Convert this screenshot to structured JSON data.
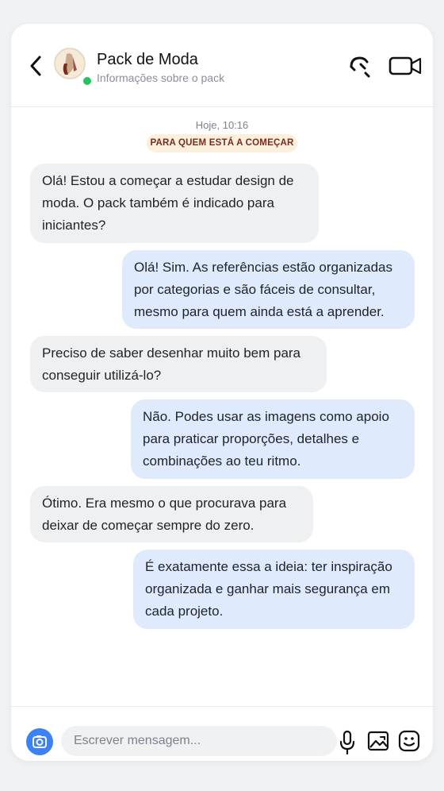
{
  "header": {
    "title": "Pack de Moda",
    "subtitle": "Informações sobre o pack",
    "back_icon": "chevron-left-icon",
    "call_icon": "phone-icon",
    "video_icon": "video-camera-icon",
    "status": "online",
    "status_color": "#22c55e"
  },
  "conversation": {
    "date_label": "Hoje, 10:16",
    "topic_badge": "PARA QUEM ESTÁ A COMEÇAR",
    "messages": [
      {
        "side": "incoming",
        "text": "Olá! Estou a começar a estudar design de\nmoda. O pack também é indicado para\niniciantes?"
      },
      {
        "side": "outgoing",
        "text": "Olá! Sim. As referências estão organizadas\npor categorias e são fáceis de consultar,\nmesmo para quem ainda está a aprender."
      },
      {
        "side": "incoming",
        "text": "Preciso de saber desenhar muito bem para\nconseguir utilizá-lo?"
      },
      {
        "side": "outgoing",
        "text": "Não. Podes usar as imagens como apoio\npara praticar proporções, detalhes e\ncombinações ao teu ritmo."
      },
      {
        "side": "incoming",
        "text": "Ótimo. Era mesmo o que procurava para\ndeixar de começar sempre do zero."
      },
      {
        "side": "outgoing",
        "text": "É exatamente essa a ideia: ter inspiração\norganizada e ganhar mais segurança em\ncada projeto."
      }
    ]
  },
  "composer": {
    "placeholder": "Escrever mensagem...",
    "value": "",
    "camera_icon": "camera-icon",
    "mic_icon": "microphone-icon",
    "image_icon": "image-icon",
    "emoji_icon": "emoji-icon"
  },
  "colors": {
    "incoming_bubble": "#eef0f2",
    "outgoing_bubble": "#dfeafc",
    "accent": "#3b82f6",
    "badge_bg": "#fbf0dc",
    "badge_text": "#7a2a22"
  }
}
